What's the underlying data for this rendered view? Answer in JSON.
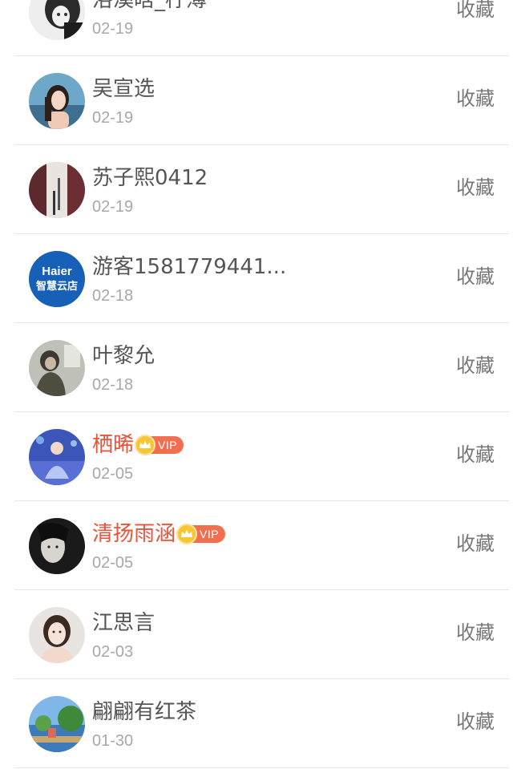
{
  "items": [
    {
      "name": "洛溪晗_柠薄",
      "date": "02-19",
      "action": "收藏",
      "vip": false,
      "avatar": "avatar-bw-boy"
    },
    {
      "name": "吴宣选",
      "date": "02-19",
      "action": "收藏",
      "vip": false,
      "avatar": "avatar-girl-sea"
    },
    {
      "name": "苏子熙0412",
      "date": "02-19",
      "action": "收藏",
      "vip": false,
      "avatar": "avatar-person-jacket"
    },
    {
      "name": "游客1581779441...",
      "date": "02-18",
      "action": "收藏",
      "vip": false,
      "avatar": "avatar-haier-logo",
      "avatar_text": [
        "Haier",
        "智慧云店"
      ]
    },
    {
      "name": "叶黎允",
      "date": "02-18",
      "action": "收藏",
      "vip": false,
      "avatar": "avatar-man-room"
    },
    {
      "name": "栖晞",
      "date": "02-05",
      "action": "收藏",
      "vip": true,
      "vip_label": "VIP",
      "avatar": "avatar-dancer-blue"
    },
    {
      "name": "清扬雨涵",
      "date": "02-05",
      "action": "收藏",
      "vip": true,
      "vip_label": "VIP",
      "avatar": "avatar-dark-face"
    },
    {
      "name": "江思言",
      "date": "02-03",
      "action": "收藏",
      "vip": false,
      "avatar": "avatar-girl-portrait"
    },
    {
      "name": "翩翩有红茶",
      "date": "01-30",
      "action": "收藏",
      "vip": false,
      "avatar": "avatar-landscape"
    }
  ],
  "colors": {
    "vip_name": "#e9533a",
    "vip_badge": "#f16f4f",
    "crown": "#f6c634",
    "name": "#555555",
    "date": "#a8a8a8",
    "action": "#777777",
    "divider": "#e6e6e6"
  }
}
